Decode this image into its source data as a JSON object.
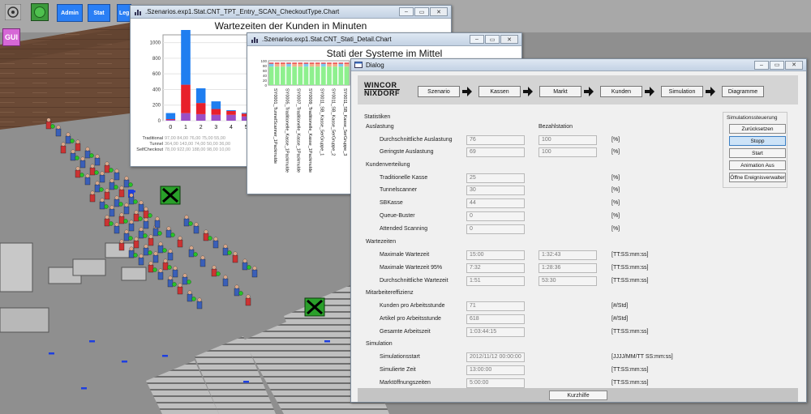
{
  "toolbar": {
    "admin_label": "Admin",
    "stat_label": "Stat",
    "legend_label": "Leg",
    "gui_label": "GUI"
  },
  "chart_window_1": {
    "title": ".Szenarios.exp1.Stat.CNT_TPT_Entry_SCAN_CheckoutType.Chart",
    "chart_title": "Wartezeiten der Kunden in Minuten",
    "table_rows": [
      {
        "label": "Traditional",
        "values": "97,00 84,00 76,00 75,00 55,00"
      },
      {
        "label": "Tunnel",
        "values": "364,00 143,00 74,00 50,00 36,00"
      },
      {
        "label": "SelfCheckout",
        "values": "78,00 922,00 188,00 98,00 10,00"
      }
    ]
  },
  "chart_window_2": {
    "title": ".Szenarios.exp1.Stat.CNT_Stati_Detail.Chart",
    "chart_title": "Stati der Systeme im Mittel"
  },
  "chart_data": [
    {
      "type": "bar",
      "title": "Wartezeiten der Kunden in Minuten",
      "categories": [
        "0",
        "1",
        "2",
        "3",
        "4",
        "5"
      ],
      "ylim": [
        0,
        1100
      ],
      "yticks": [
        "0",
        "200",
        "400",
        "600",
        "800",
        "1000"
      ],
      "series": [
        {
          "name": "Traditional",
          "color": "#9b4fc6",
          "values": [
            10,
            97,
            84,
            76,
            75,
            55
          ]
        },
        {
          "name": "Tunnel",
          "color": "#e8202a",
          "values": [
            10,
            364,
            143,
            74,
            50,
            36
          ]
        },
        {
          "name": "SelfCheckout",
          "color": "#1f7ef0",
          "values": [
            78,
            922,
            188,
            98,
            10,
            10
          ]
        }
      ]
    },
    {
      "type": "bar",
      "title": "Stati der Systeme im Mittel",
      "ylim": [
        0,
        100
      ],
      "yticks": [
        "0",
        "20",
        "40",
        "60",
        "80",
        "100"
      ],
      "categories": [
        "SY0001_TunnelScanner_1Packmulde",
        "SY0005_Traditionelle_Kasse_1Packmulde",
        "SY0007_Traditionelle_Kasse_1Packmulde",
        "SY0009_Traditionelle_Kasse_1Packmulde",
        "SY0011_SB_Kasse_5erGruppe_1",
        "SY0011_SB_Kasse_5erGruppe_2",
        "SY0011_SB_Kasse_5erGruppe_3"
      ]
    }
  ],
  "dialog": {
    "title": "Dialog",
    "logo_line1": "WINCOR",
    "logo_line2": "NIXDORF",
    "flow": [
      "Szenario",
      "Kassen",
      "Markt",
      "Kunden",
      "Simulation",
      "Diagramme"
    ],
    "sections": {
      "statistiken": "Statistiken",
      "auslastung": "Auslastung",
      "bezahlstation": "Bezahlstation",
      "kundenverteilung": "Kundenverteilung",
      "wartezeiten": "Wartezeiten",
      "mitarbeiter": "Mitarbeitereffizienz",
      "simulation": "Simulation"
    },
    "rows": {
      "durchschnittliche_auslastung": {
        "label": "Durchschnittliche Auslastung",
        "v1": "76",
        "v2": "100",
        "unit": "[%]"
      },
      "geringste_auslastung": {
        "label": "Geringste Auslastung",
        "v1": "69",
        "v2": "100",
        "unit": "[%]"
      },
      "traditionelle_kasse": {
        "label": "Traditionelle Kasse",
        "v1": "25",
        "unit": "[%]"
      },
      "tunnelscanner": {
        "label": "Tunnelscanner",
        "v1": "30",
        "unit": "[%]"
      },
      "sbkasse": {
        "label": "SBKasse",
        "v1": "44",
        "unit": "[%]"
      },
      "queue_buster": {
        "label": "Queue-Buster",
        "v1": "0",
        "unit": "[%]"
      },
      "attended_scanning": {
        "label": "Attended Scanning",
        "v1": "0",
        "unit": "[%]"
      },
      "maximale_wartezeit": {
        "label": "Maximale Wartezeit",
        "v1": "15:00",
        "v2": "1:32:43",
        "unit": "[TT:SS:mm:ss]"
      },
      "maximale_wartezeit_95": {
        "label": "Maximale Wartezeit 95%",
        "v1": "7:32",
        "v2": "1:28:36",
        "unit": "[TT:SS:mm:ss]"
      },
      "durchschnittliche_wartezeit": {
        "label": "Durchschnittliche Wartezeit",
        "v1": "1:51",
        "v2": "53:30",
        "unit": "[TT:SS:mm:ss]"
      },
      "kunden_pro_stunde": {
        "label": "Kunden pro Arbeitsstunde",
        "v1": "71",
        "unit": "[#/Std]"
      },
      "artikel_pro_stunde": {
        "label": "Artikel pro Arbeitsstunde",
        "v1": "618",
        "unit": "[#/Std]"
      },
      "gesamte_arbeitszeit": {
        "label": "Gesamte Arbeitszeit",
        "v1": "1:03:44:15",
        "unit": "[TT:SS:mm:ss]"
      },
      "simulationsstart": {
        "label": "Simulationsstart",
        "v1": "2012/11/12 00:00:00",
        "unit": "[JJJJ/MM/TT SS:mm:ss]"
      },
      "simulierte_zeit": {
        "label": "Simulierte Zeit",
        "v1": "13:00:00",
        "unit": "[TT:SS:mm:ss]"
      },
      "marktoeffnungszeiten": {
        "label": "Marktöffnungszeiten",
        "v1": "5:00:00",
        "unit": "[TT:SS:mm:ss]"
      }
    },
    "steuerung": {
      "title": "Simulationssteuerung",
      "zuruecksetzen": "Zurücksetzen",
      "stopp": "Stopp",
      "start": "Start",
      "animation_aus": "Animation Aus",
      "ereignisverwalter": "Öffne Ereignisverwalter"
    },
    "kurzhilfe": "Kurzhilfe"
  }
}
